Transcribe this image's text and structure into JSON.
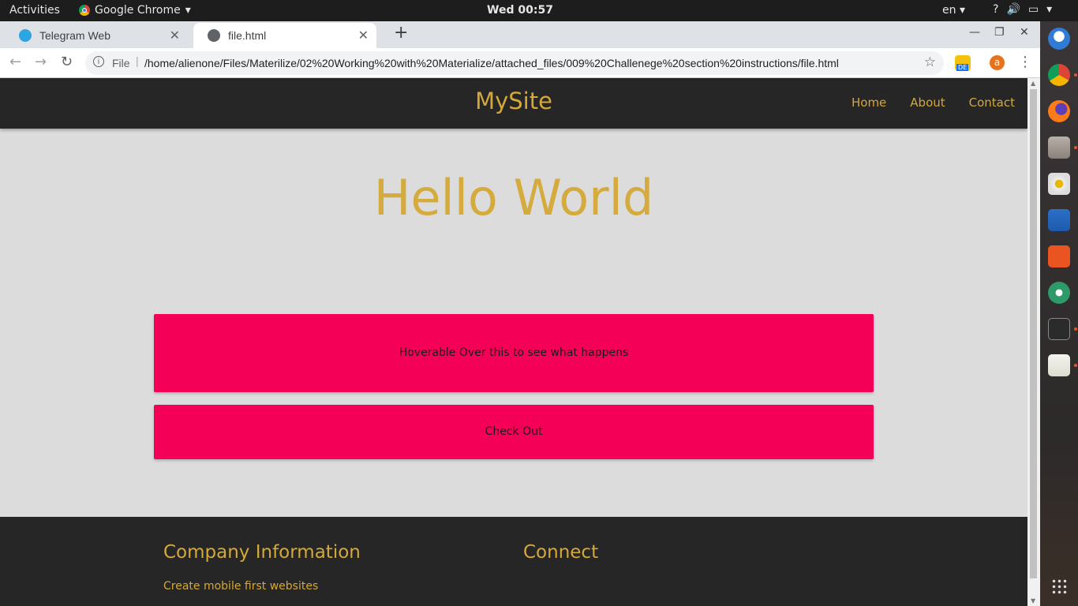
{
  "system_bar": {
    "activities": "Activities",
    "app_name": "Google Chrome",
    "clock": "Wed 00:57",
    "language": "en"
  },
  "browser": {
    "tabs": [
      {
        "title": "Telegram Web",
        "icon": "telegram-icon",
        "active": false
      },
      {
        "title": "file.html",
        "icon": "globe-icon",
        "active": true
      }
    ],
    "address": {
      "scheme": "File",
      "url": "/home/alienone/Files/Materilize/02%20Working%20with%20Materialize/attached_files/009%20Challenege%20section%20instructions/file.html"
    },
    "extensions": {
      "translate_badge": "DE",
      "avatar_letter": "a"
    }
  },
  "site": {
    "brand": "MySite",
    "nav": [
      "Home",
      "About",
      "Contact"
    ],
    "hero_title": "Hello World",
    "cards": [
      "Hoverable Over this to see what happens",
      "Check Out"
    ],
    "footer": {
      "company_heading": "Company Information",
      "company_text": "Create mobile first websites",
      "connect_heading": "Connect"
    },
    "colors": {
      "accent": "#d4a83a",
      "card": "#f50057",
      "nav_bg": "#262626",
      "page_bg": "#dcdcdc"
    }
  },
  "dock": {
    "apps": [
      "thunderbird-icon",
      "chrome-icon",
      "firefox-icon",
      "files-icon",
      "rhythmbox-icon",
      "writer-icon",
      "software-icon",
      "atom-icon",
      "terminal-icon",
      "text-editor-icon",
      "app-grid-icon"
    ]
  }
}
